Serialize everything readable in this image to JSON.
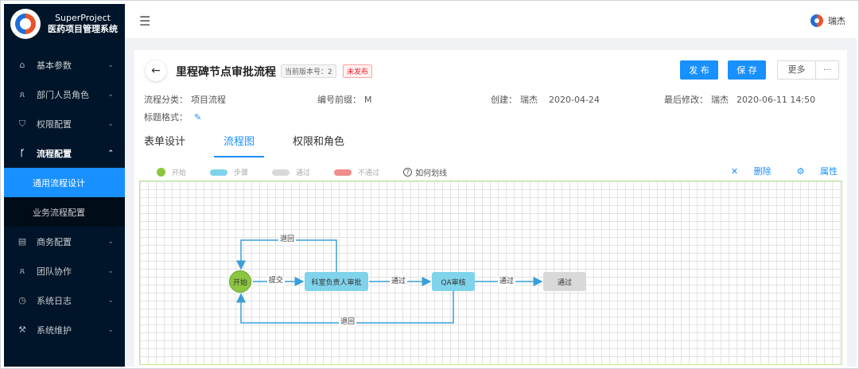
{
  "app": {
    "name": "SuperProject",
    "subtitle": "医药项目管理系统",
    "user": "瑞杰"
  },
  "sidebar": {
    "items": [
      {
        "label": "基本参数",
        "icon": "home-icon",
        "expanded": false
      },
      {
        "label": "部门人员角色",
        "icon": "users-icon",
        "expanded": false
      },
      {
        "label": "权限配置",
        "icon": "shield-icon",
        "expanded": false
      },
      {
        "label": "流程配置",
        "icon": "branch-icon",
        "expanded": true,
        "children": [
          {
            "label": "通用流程设计",
            "active": true
          },
          {
            "label": "业务流程配置",
            "active": false
          }
        ]
      },
      {
        "label": "商务配置",
        "icon": "document-icon",
        "expanded": false
      },
      {
        "label": "团队协作",
        "icon": "team-icon",
        "expanded": false
      },
      {
        "label": "系统日志",
        "icon": "clock-icon",
        "expanded": false
      },
      {
        "label": "系统维护",
        "icon": "wrench-icon",
        "expanded": false
      }
    ]
  },
  "header": {
    "title": "里程碑节点审批流程",
    "version_label": "当前版本号：2",
    "status_badge": "未发布",
    "publish": "发 布",
    "save": "保 存",
    "more": "更多",
    "more_dots": "···"
  },
  "meta": {
    "category_label": "流程分类：",
    "category_value": "项目流程",
    "prefix_label": "编号前缀：",
    "prefix_value": "M",
    "created_label": "创建：",
    "created_by": "瑞杰",
    "created_date": "2020-04-24",
    "modified_label": "最后修改：",
    "modified_by": "瑞杰",
    "modified_date": "2020-06-11 14:50",
    "title_format_label": "标题格式："
  },
  "tabs": [
    {
      "label": "表单设计",
      "active": false
    },
    {
      "label": "流程图",
      "active": true
    },
    {
      "label": "权限和角色",
      "active": false
    }
  ],
  "legend": {
    "start": "开始",
    "step": "步骤",
    "pass": "通过",
    "reject": "不通过",
    "howto": "如何划线"
  },
  "tools": {
    "delete": "删除",
    "properties": "属性"
  },
  "colors": {
    "start": "#8cc63f",
    "step": "#7fd3ea",
    "pass": "#d9d9d9",
    "reject": "#f08c8c",
    "edge": "#3a9fd8",
    "accent": "#1890ff"
  },
  "flow": {
    "nodes": {
      "start": "开始",
      "review1": "科室负责人审批",
      "review2": "QA审核",
      "pass": "通过"
    },
    "edges": {
      "submit": "提交",
      "pass1": "通过",
      "pass2": "通过",
      "return_top": "退回",
      "return_bottom": "退回"
    }
  }
}
